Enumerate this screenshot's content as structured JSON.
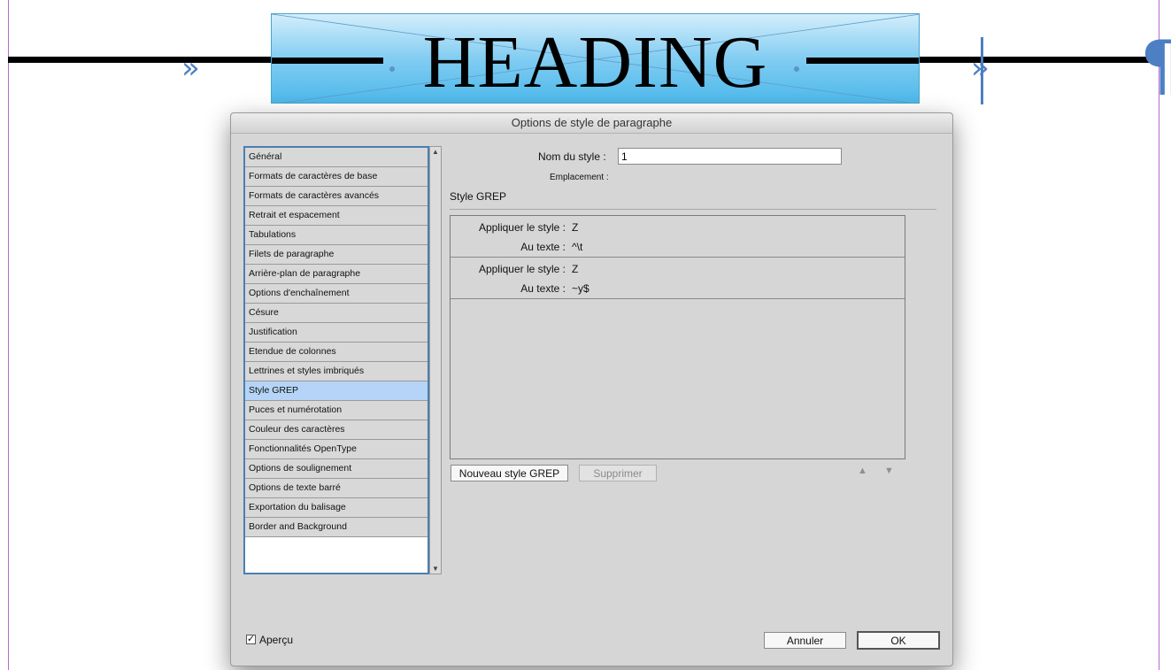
{
  "document": {
    "heading_text": "HEADING",
    "pilcrow_glyph": "¶",
    "chevron_glyph": "»"
  },
  "dialog": {
    "title": "Options de style de paragraphe",
    "categories": [
      {
        "label": "Général"
      },
      {
        "label": "Formats de caractères de base"
      },
      {
        "label": "Formats de caractères avancés"
      },
      {
        "label": "Retrait et espacement"
      },
      {
        "label": "Tabulations"
      },
      {
        "label": "Filets de paragraphe"
      },
      {
        "label": "Arrière-plan de paragraphe"
      },
      {
        "label": "Options d'enchaînement"
      },
      {
        "label": "Césure"
      },
      {
        "label": "Justification"
      },
      {
        "label": "Etendue de colonnes"
      },
      {
        "label": "Lettrines et styles imbriqués"
      },
      {
        "label": "Style GREP"
      },
      {
        "label": "Puces et numérotation"
      },
      {
        "label": "Couleur des caractères"
      },
      {
        "label": "Fonctionnalités OpenType"
      },
      {
        "label": "Options de soulignement"
      },
      {
        "label": "Options de texte barré"
      },
      {
        "label": "Exportation du balisage"
      },
      {
        "label": "Border and Background"
      }
    ],
    "selected_category": "Style GREP",
    "style_name_label": "Nom du style :",
    "style_name_value": "1",
    "location_label": "Emplacement :",
    "section_title": "Style GREP",
    "grep_rules": [
      {
        "apply_label": "Appliquer le style :",
        "apply_value": "Z",
        "text_label": "Au texte :",
        "text_value": "^\\t"
      },
      {
        "apply_label": "Appliquer le style :",
        "apply_value": "Z",
        "text_label": "Au texte :",
        "text_value": "~y$"
      }
    ],
    "new_grep_button": "Nouveau style GREP",
    "delete_button": "Supprimer",
    "preview_label": "Aperçu",
    "preview_checked": true,
    "cancel_button": "Annuler",
    "ok_button": "OK"
  },
  "colors": {
    "selection": "#b5d4f7",
    "list_border": "#4b7fb0",
    "guide": "#b66ad0",
    "accent_blue": "#4d7fc4"
  }
}
